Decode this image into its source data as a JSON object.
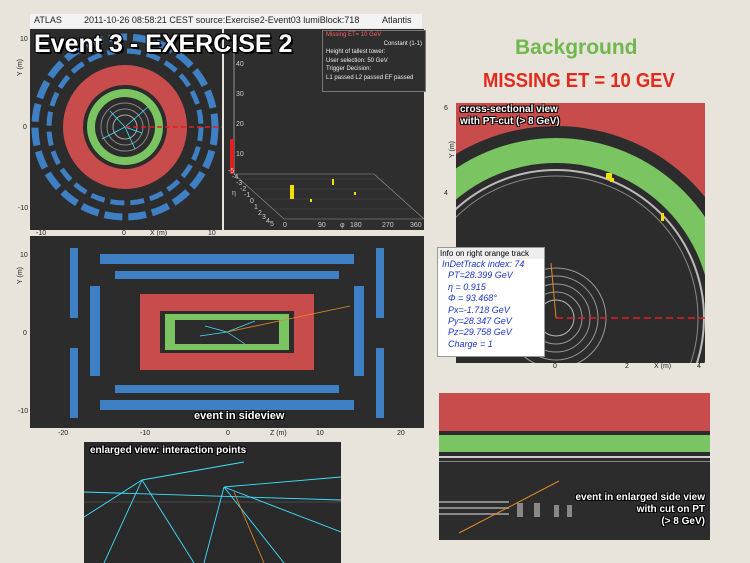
{
  "header": {
    "app": "ATLAS",
    "timestamp": "2011-10-26 08:58:21 CEST source:Exercise2-Event03 lumiBlock:718",
    "brand": "Atlantis"
  },
  "titles": {
    "main": "Event 3 - EXERCISE 2",
    "background": "Background",
    "missing_et": "MISSING ET = 10 GEV"
  },
  "legend": {
    "lines": [
      "Missing ET= 10 GeV",
      "Constant (1-1)",
      "Height of tallest tower:",
      "User selection: 50 GeV",
      "Trigger Decision:",
      "L1 passed L2 passed EF passed"
    ]
  },
  "xy_view": {
    "y_label": "Y (m)",
    "x_label": "X (m)",
    "y_ticks": [
      "10",
      "0",
      "-10"
    ],
    "x_ticks": [
      "-10",
      "0",
      "10"
    ]
  },
  "lego_view": {
    "z_ticks": [
      "40",
      "30",
      "20",
      "10"
    ],
    "phi_ticks": [
      "0",
      "90",
      "180",
      "270",
      "360"
    ],
    "eta_ticks": [
      "-5",
      "-4",
      "-3",
      "-2",
      "-1",
      "0",
      "1",
      "2",
      "3",
      "4",
      "5"
    ],
    "eta_symbol": "η",
    "phi_symbol": "φ"
  },
  "side_view": {
    "caption": "event in sideview",
    "y_label": "Y (m)",
    "x_label": "Z (m)",
    "x_ticks": [
      "-20",
      "-10",
      "0",
      "10",
      "20"
    ],
    "y_ticks": [
      "10",
      "0",
      "-10"
    ]
  },
  "cross_section": {
    "caption_line1": "cross-sectional view",
    "caption_line2": "with PT-cut  (> 8 GeV)",
    "y_label": "Y (m)",
    "x_label": "X (m)",
    "y_ticks": [
      "6",
      "4",
      "2",
      "0"
    ],
    "x_ticks": [
      "0",
      "2",
      "4"
    ]
  },
  "track_info": {
    "title": "Info on right orange track",
    "lines": [
      "InDetTrack index: 74",
      "PT=28.399 GeV",
      "η = 0.915",
      "Φ = 93.468°",
      "Px=-1.718 GeV",
      "Py=28.347 GeV",
      "Pz=29.758 GeV",
      "Charge = 1"
    ]
  },
  "interaction": {
    "caption": "enlarged view: interaction points"
  },
  "enlarged_side": {
    "caption_line1": "event in enlarged side view",
    "caption_line2": "with cut on PT",
    "caption_line3": "(> 8 GeV)"
  },
  "colors": {
    "calo_red": "#c84c4c",
    "calo_green": "#7ac461",
    "muon_blue": "#3f7fc4",
    "track_cyan": "#3fe0ff",
    "met_red": "#e02020"
  }
}
